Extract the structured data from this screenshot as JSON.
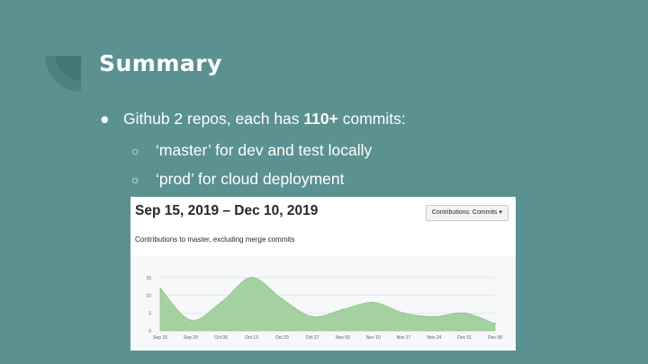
{
  "slide": {
    "title": "Summary",
    "bullet": {
      "prefix": "Github 2 repos, each has ",
      "bold": "110+",
      "suffix": " commits:"
    },
    "subbullets": [
      "‘master’ for dev and test locally",
      "‘prod’ for cloud deployment"
    ]
  },
  "github": {
    "date_range": "Sep 15, 2019 – Dec 10, 2019",
    "dropdown_label": "Contributions: Commits ▾",
    "caption": "Contributions to master, excluding merge commits"
  },
  "chart_data": {
    "type": "area",
    "title": "",
    "x": [
      "Sep 15",
      "Sep 29",
      "Oct 06",
      "Oct 13",
      "Oct 20",
      "Oct 27",
      "Nov 03",
      "Nov 10",
      "Nov 17",
      "Nov 24",
      "Dec 01",
      "Dec 08"
    ],
    "values": [
      12,
      3,
      8,
      15,
      9,
      4,
      6,
      8,
      5,
      4,
      5,
      2
    ],
    "yticks": [
      0,
      5,
      10,
      15
    ],
    "ylim": [
      0,
      18
    ],
    "color": "#a3d2a0",
    "grid": true
  }
}
